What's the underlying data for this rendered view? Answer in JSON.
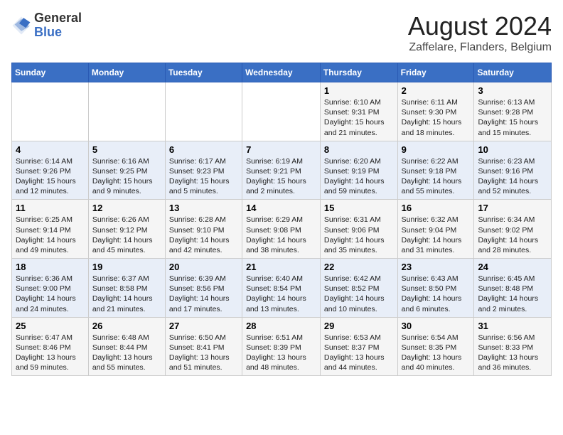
{
  "header": {
    "logo_general": "General",
    "logo_blue": "Blue",
    "month_year": "August 2024",
    "location": "Zaffelare, Flanders, Belgium"
  },
  "days_of_week": [
    "Sunday",
    "Monday",
    "Tuesday",
    "Wednesday",
    "Thursday",
    "Friday",
    "Saturday"
  ],
  "weeks": [
    [
      {
        "day": "",
        "info": ""
      },
      {
        "day": "",
        "info": ""
      },
      {
        "day": "",
        "info": ""
      },
      {
        "day": "",
        "info": ""
      },
      {
        "day": "1",
        "info": "Sunrise: 6:10 AM\nSunset: 9:31 PM\nDaylight: 15 hours and 21 minutes."
      },
      {
        "day": "2",
        "info": "Sunrise: 6:11 AM\nSunset: 9:30 PM\nDaylight: 15 hours and 18 minutes."
      },
      {
        "day": "3",
        "info": "Sunrise: 6:13 AM\nSunset: 9:28 PM\nDaylight: 15 hours and 15 minutes."
      }
    ],
    [
      {
        "day": "4",
        "info": "Sunrise: 6:14 AM\nSunset: 9:26 PM\nDaylight: 15 hours and 12 minutes."
      },
      {
        "day": "5",
        "info": "Sunrise: 6:16 AM\nSunset: 9:25 PM\nDaylight: 15 hours and 9 minutes."
      },
      {
        "day": "6",
        "info": "Sunrise: 6:17 AM\nSunset: 9:23 PM\nDaylight: 15 hours and 5 minutes."
      },
      {
        "day": "7",
        "info": "Sunrise: 6:19 AM\nSunset: 9:21 PM\nDaylight: 15 hours and 2 minutes."
      },
      {
        "day": "8",
        "info": "Sunrise: 6:20 AM\nSunset: 9:19 PM\nDaylight: 14 hours and 59 minutes."
      },
      {
        "day": "9",
        "info": "Sunrise: 6:22 AM\nSunset: 9:18 PM\nDaylight: 14 hours and 55 minutes."
      },
      {
        "day": "10",
        "info": "Sunrise: 6:23 AM\nSunset: 9:16 PM\nDaylight: 14 hours and 52 minutes."
      }
    ],
    [
      {
        "day": "11",
        "info": "Sunrise: 6:25 AM\nSunset: 9:14 PM\nDaylight: 14 hours and 49 minutes."
      },
      {
        "day": "12",
        "info": "Sunrise: 6:26 AM\nSunset: 9:12 PM\nDaylight: 14 hours and 45 minutes."
      },
      {
        "day": "13",
        "info": "Sunrise: 6:28 AM\nSunset: 9:10 PM\nDaylight: 14 hours and 42 minutes."
      },
      {
        "day": "14",
        "info": "Sunrise: 6:29 AM\nSunset: 9:08 PM\nDaylight: 14 hours and 38 minutes."
      },
      {
        "day": "15",
        "info": "Sunrise: 6:31 AM\nSunset: 9:06 PM\nDaylight: 14 hours and 35 minutes."
      },
      {
        "day": "16",
        "info": "Sunrise: 6:32 AM\nSunset: 9:04 PM\nDaylight: 14 hours and 31 minutes."
      },
      {
        "day": "17",
        "info": "Sunrise: 6:34 AM\nSunset: 9:02 PM\nDaylight: 14 hours and 28 minutes."
      }
    ],
    [
      {
        "day": "18",
        "info": "Sunrise: 6:36 AM\nSunset: 9:00 PM\nDaylight: 14 hours and 24 minutes."
      },
      {
        "day": "19",
        "info": "Sunrise: 6:37 AM\nSunset: 8:58 PM\nDaylight: 14 hours and 21 minutes."
      },
      {
        "day": "20",
        "info": "Sunrise: 6:39 AM\nSunset: 8:56 PM\nDaylight: 14 hours and 17 minutes."
      },
      {
        "day": "21",
        "info": "Sunrise: 6:40 AM\nSunset: 8:54 PM\nDaylight: 14 hours and 13 minutes."
      },
      {
        "day": "22",
        "info": "Sunrise: 6:42 AM\nSunset: 8:52 PM\nDaylight: 14 hours and 10 minutes."
      },
      {
        "day": "23",
        "info": "Sunrise: 6:43 AM\nSunset: 8:50 PM\nDaylight: 14 hours and 6 minutes."
      },
      {
        "day": "24",
        "info": "Sunrise: 6:45 AM\nSunset: 8:48 PM\nDaylight: 14 hours and 2 minutes."
      }
    ],
    [
      {
        "day": "25",
        "info": "Sunrise: 6:47 AM\nSunset: 8:46 PM\nDaylight: 13 hours and 59 minutes."
      },
      {
        "day": "26",
        "info": "Sunrise: 6:48 AM\nSunset: 8:44 PM\nDaylight: 13 hours and 55 minutes."
      },
      {
        "day": "27",
        "info": "Sunrise: 6:50 AM\nSunset: 8:41 PM\nDaylight: 13 hours and 51 minutes."
      },
      {
        "day": "28",
        "info": "Sunrise: 6:51 AM\nSunset: 8:39 PM\nDaylight: 13 hours and 48 minutes."
      },
      {
        "day": "29",
        "info": "Sunrise: 6:53 AM\nSunset: 8:37 PM\nDaylight: 13 hours and 44 minutes."
      },
      {
        "day": "30",
        "info": "Sunrise: 6:54 AM\nSunset: 8:35 PM\nDaylight: 13 hours and 40 minutes."
      },
      {
        "day": "31",
        "info": "Sunrise: 6:56 AM\nSunset: 8:33 PM\nDaylight: 13 hours and 36 minutes."
      }
    ]
  ]
}
